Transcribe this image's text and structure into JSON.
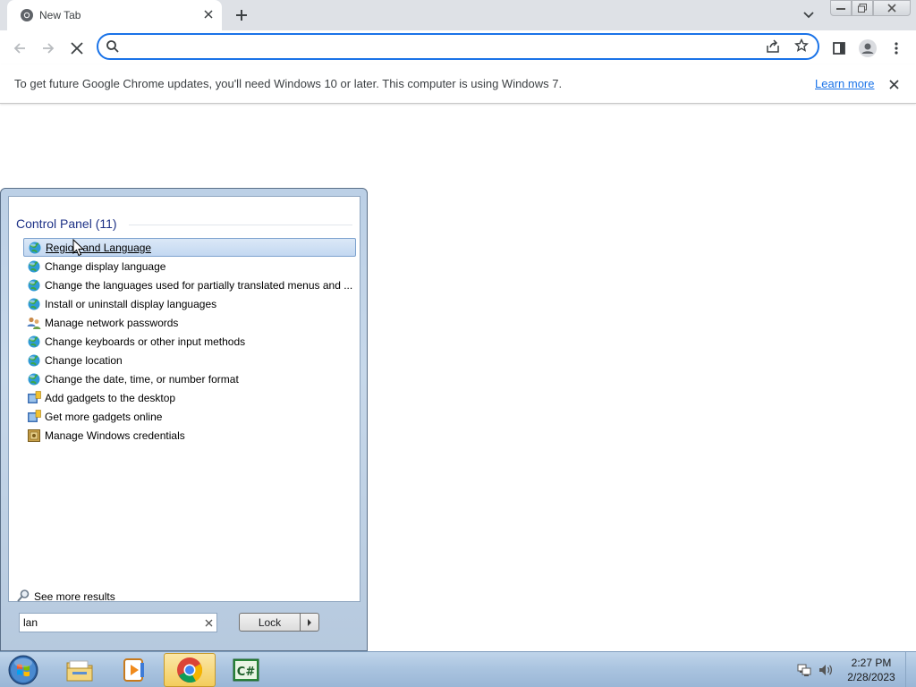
{
  "browser": {
    "tab": {
      "title": "New Tab"
    },
    "omnibox": {
      "value": "",
      "placeholder": ""
    },
    "infobar": {
      "message": "To get future Google Chrome updates, you'll need Windows 10 or later. This computer is using Windows 7.",
      "link": "Learn more"
    },
    "accent_color": "#1a73e8",
    "icons": [
      "back-icon",
      "forward-icon",
      "stop-icon",
      "search-icon",
      "share-icon",
      "bookmark-star-icon",
      "side-panel-icon",
      "profile-icon",
      "menu-icon"
    ]
  },
  "start_menu": {
    "group_header": "Control Panel (11)",
    "results": [
      {
        "label": "Region and Language",
        "icon": "globe-icon",
        "selected": true
      },
      {
        "label": "Change display language",
        "icon": "globe-icon"
      },
      {
        "label": "Change the languages used for partially translated menus and ...",
        "icon": "globe-icon"
      },
      {
        "label": "Install or uninstall display languages",
        "icon": "globe-icon"
      },
      {
        "label": "Manage network passwords",
        "icon": "users-icon"
      },
      {
        "label": "Change keyboards or other input methods",
        "icon": "globe-icon"
      },
      {
        "label": "Change location",
        "icon": "globe-icon"
      },
      {
        "label": "Change the date, time, or number format",
        "icon": "globe-icon"
      },
      {
        "label": "Add gadgets to the desktop",
        "icon": "gadgets-icon"
      },
      {
        "label": "Get more gadgets online",
        "icon": "gadgets-icon"
      },
      {
        "label": "Manage Windows credentials",
        "icon": "vault-icon"
      }
    ],
    "see_more": "See more results",
    "search": {
      "value": "lan"
    },
    "lock_button": "Lock"
  },
  "taskbar": {
    "apps": [
      "start-orb-icon",
      "explorer-icon",
      "media-player-icon",
      "chrome-icon",
      "csharp-icon"
    ],
    "active_app": "chrome-icon",
    "clock": {
      "time": "2:27 PM",
      "date": "2/28/2023"
    }
  }
}
